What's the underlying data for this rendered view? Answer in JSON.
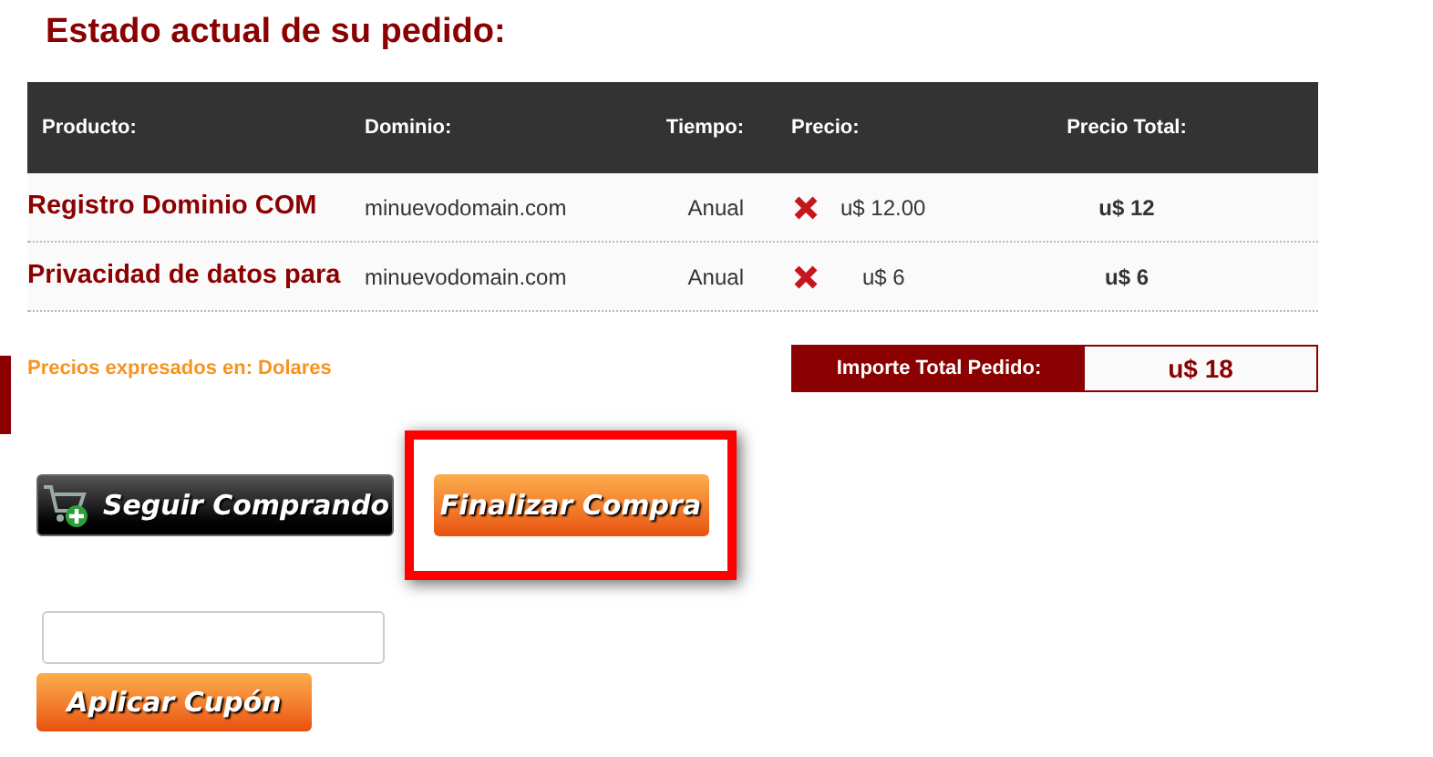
{
  "title": "Estado actual de su pedido:",
  "table": {
    "columns": [
      "Producto:",
      "Dominio:",
      "Tiempo:",
      "Precio:",
      "Precio Total:"
    ],
    "rows": [
      {
        "product": "Registro Dominio COM",
        "domain": "minuevodomain.com",
        "term": "Anual",
        "price": "u$ 12.00",
        "total": "u$ 12"
      },
      {
        "product": "Privacidad de datos para",
        "domain": "minuevodomain.com",
        "term": "Anual",
        "price": "u$ 6",
        "total": "u$ 6"
      }
    ]
  },
  "currency_note": "Precios expresados en: Dolares",
  "order_total": {
    "label": "Importe Total Pedido:",
    "value": "u$ 18"
  },
  "buttons": [
    {
      "label": "Seguir Comprando",
      "kind": "dark",
      "highlighted": false
    },
    {
      "label": "Finalizar Compra",
      "kind": "orange",
      "highlighted": true
    }
  ],
  "coupon": {
    "button": "Aplicar Cupón"
  }
}
